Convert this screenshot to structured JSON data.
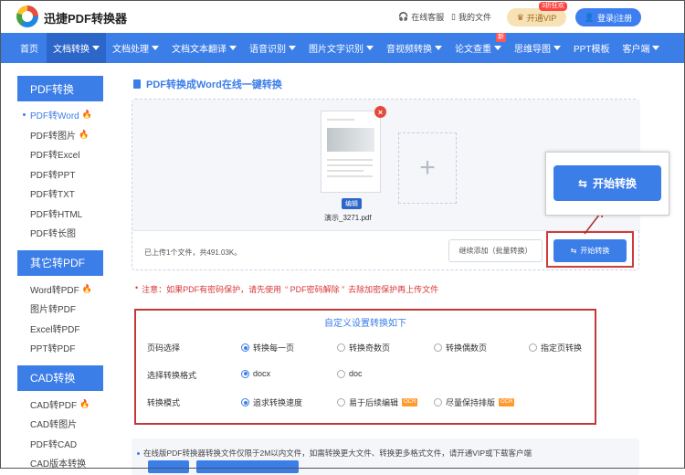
{
  "header": {
    "brand": "迅捷PDF转换器",
    "service": "在线客服",
    "my_files": "我的文件",
    "vip_tag": "3折狂欢",
    "vip": "开通VIP",
    "login": "登录|注册"
  },
  "nav": {
    "items": [
      {
        "label": "首页",
        "caret": false
      },
      {
        "label": "文档转换",
        "caret": true
      },
      {
        "label": "文档处理",
        "caret": true
      },
      {
        "label": "文档文本翻译",
        "caret": true
      },
      {
        "label": "语音识别",
        "caret": true
      },
      {
        "label": "图片文字识别",
        "caret": true
      },
      {
        "label": "音视频转换",
        "caret": true
      },
      {
        "label": "论文查重",
        "caret": true,
        "badge": "新"
      },
      {
        "label": "思维导图",
        "caret": true
      },
      {
        "label": "PPT模板",
        "caret": false
      },
      {
        "label": "客户端",
        "caret": true
      }
    ]
  },
  "sidebar": {
    "groups": [
      {
        "title": "PDF转换",
        "items": [
          {
            "label": "PDF转Word",
            "hot": true,
            "active": true
          },
          {
            "label": "PDF转图片",
            "hot": true
          },
          {
            "label": "PDF转Excel"
          },
          {
            "label": "PDF转PPT"
          },
          {
            "label": "PDF转TXT"
          },
          {
            "label": "PDF转HTML"
          },
          {
            "label": "PDF转长图"
          }
        ]
      },
      {
        "title": "其它转PDF",
        "items": [
          {
            "label": "Word转PDF",
            "hot": true
          },
          {
            "label": "图片转PDF"
          },
          {
            "label": "Excel转PDF"
          },
          {
            "label": "PPT转PDF"
          }
        ]
      },
      {
        "title": "CAD转换",
        "items": [
          {
            "label": "CAD转PDF",
            "hot": true
          },
          {
            "label": "CAD转图片"
          },
          {
            "label": "PDF转CAD"
          },
          {
            "label": "CAD版本转换"
          }
        ]
      }
    ]
  },
  "main": {
    "title": "PDF转换成Word在线一键转换",
    "file": {
      "edit": "编辑",
      "name": "演示_3271.pdf"
    },
    "add_symbol": "+",
    "upload_info": "已上传1个文件，共491.03K。",
    "continue_btn": "继续添加（批量转换）",
    "start_btn": "开始转换",
    "zoom_btn": "开始转换",
    "notice": {
      "prefix": "注意：如果PDF有密码保护，请先使用",
      "link": "“ PDF密码解除 ”",
      "suffix": "去除加密保护再上传文件"
    },
    "settings": {
      "title": "自定义设置转换如下",
      "rows": [
        {
          "label": "页码选择",
          "options": [
            {
              "text": "转换每一页",
              "selected": true
            },
            {
              "text": "转换奇数页",
              "selected": false
            },
            {
              "text": "转换偶数页",
              "selected": false
            },
            {
              "text": "指定页转换",
              "selected": false
            }
          ]
        },
        {
          "label": "选择转换格式",
          "options": [
            {
              "text": "docx",
              "selected": true
            },
            {
              "text": "doc",
              "selected": false
            }
          ]
        },
        {
          "label": "转换模式",
          "options": [
            {
              "text": "追求转换速度",
              "selected": true
            },
            {
              "text": "易于后续编辑",
              "selected": false,
              "ocr": "OCR"
            },
            {
              "text": "尽量保持排版",
              "selected": false,
              "ocr": "OCR"
            }
          ]
        }
      ]
    },
    "bottom_text": "在线版PDF转换器转换文件仅限于2M以内文件，如需转换更大文件、转换更多格式文件，请开通VIP或下载客户端"
  },
  "colors": {
    "primary": "#3c7ee8",
    "nav_active": "#2c66c8",
    "alert": "#d83535",
    "ocr": "#ff9a2e"
  }
}
